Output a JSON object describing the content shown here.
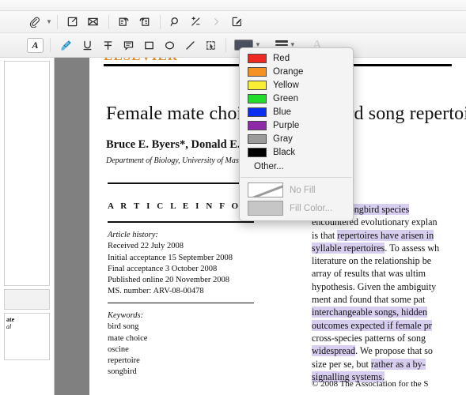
{
  "window": {
    "title": ""
  },
  "toolbar_top": {
    "items": [
      {
        "name": "attachment-icon",
        "label": "Attachment",
        "has_chevron": true
      },
      {
        "name": "export-icon",
        "label": "Export"
      },
      {
        "name": "mail-icon",
        "label": "Mail"
      },
      {
        "name": "rotate-left-icon",
        "label": "Rotate Left"
      },
      {
        "name": "rotate-right-icon",
        "label": "Rotate Right"
      },
      {
        "name": "search-icon",
        "label": "Search"
      },
      {
        "name": "crop-icon",
        "label": "Crop"
      },
      {
        "name": "chevron-right-icon",
        "label": "Next"
      },
      {
        "name": "markup-icon",
        "label": "Markup"
      }
    ]
  },
  "toolbar_markup": {
    "items": [
      {
        "name": "text-box-icon",
        "label": "Text Box"
      },
      {
        "name": "highlight-pen-icon",
        "label": "Highlight"
      },
      {
        "name": "underline-icon",
        "label": "Underline"
      },
      {
        "name": "strikethrough-icon",
        "label": "Strikethrough"
      },
      {
        "name": "note-icon",
        "label": "Note"
      },
      {
        "name": "rectangle-icon",
        "label": "Rectangle"
      },
      {
        "name": "oval-icon",
        "label": "Oval"
      },
      {
        "name": "line-icon",
        "label": "Line"
      },
      {
        "name": "selection-icon",
        "label": "Selection"
      }
    ],
    "border_color_swatch": "#4c5260",
    "border_color_label": "Border Color",
    "line_style_label": "Line Style",
    "font_label": "A"
  },
  "color_menu": {
    "colors": [
      {
        "label": "Red",
        "hex": "#ee2a23"
      },
      {
        "label": "Orange",
        "hex": "#f59122"
      },
      {
        "label": "Yellow",
        "hex": "#f9ee34"
      },
      {
        "label": "Green",
        "hex": "#22dd2c"
      },
      {
        "label": "Blue",
        "hex": "#0a2ff0"
      },
      {
        "label": "Purple",
        "hex": "#8e2aa8"
      },
      {
        "label": "Gray",
        "hex": "#9b9b9b"
      },
      {
        "label": "Black",
        "hex": "#000000"
      }
    ],
    "other_label": "Other...",
    "no_fill_label": "No Fill",
    "fill_color_label": "Fill Color...",
    "fill_color_swatch": "#c6c6c6"
  },
  "sidebar": {
    "thumbnails": [
      {
        "name": "page-thumbnail-1",
        "text_line1": "",
        "text_line2": "",
        "blank": true
      },
      {
        "name": "page-thumbnail-2",
        "text_line1": "",
        "text_line2": "",
        "blank": true
      },
      {
        "name": "page-thumbnail-3",
        "text_line1": "ate",
        "text_line2": "al",
        "blank": false
      }
    ]
  },
  "document": {
    "publisher": "ELSEVIER",
    "title": "Female mate choice and songbird song repertoires",
    "authors": "Bruce E. Byers*, Donald E. Kroodsma",
    "affiliation": "Department of Biology, University of Massachusetts, Amherst",
    "article_info_heading": "A R T I C L E  I N F O",
    "article_history": {
      "lead": "Article history:",
      "lines": [
        "Received 22 July 2008",
        "Initial acceptance 15 September 2008",
        "Final acceptance 3 October 2008",
        "Published online 20 November 2008",
        "MS. number: ARV-08-00478"
      ]
    },
    "keywords": {
      "lead": "Keywords:",
      "lines": [
        "bird song",
        "mate choice",
        "oscine",
        "repertoire",
        "songbird"
      ]
    },
    "abstract_lines": [
      [
        {
          "t": "of many songbird species",
          "hl": true
        }
      ],
      [
        {
          "t": "encountered evolutionary explan",
          "hl": false
        }
      ],
      [
        {
          "t": "is that ",
          "hl": false
        },
        {
          "t": "repertoires have arisen in",
          "hl": true
        }
      ],
      [
        {
          "t": "syllable repertoires",
          "hl": true
        },
        {
          "t": ". To assess wh",
          "hl": false
        }
      ],
      [
        {
          "t": "literature on the relationship be",
          "hl": false
        }
      ],
      [
        {
          "t": "array of results that was ultim",
          "hl": false
        }
      ],
      [
        {
          "t": "hypothesis. Given the ambiguity",
          "hl": false
        }
      ],
      [
        {
          "t": "ment and found that some pat",
          "hl": false
        }
      ],
      [
        {
          "t": "interchangeable songs, hidden",
          "hl": true
        }
      ],
      [
        {
          "t": "outcomes expected if female pr",
          "hl": true
        }
      ],
      [
        {
          "t": "cross-species patterns of song",
          "hl": false
        }
      ],
      [
        {
          "t": "widespread",
          "hl": true
        },
        {
          "t": ". We propose that so",
          "hl": false
        }
      ],
      [
        {
          "t": "size per se, but ",
          "hl": false
        },
        {
          "t": "rather as a by-",
          "hl": true
        }
      ],
      [
        {
          "t": "signalling systems.",
          "hl": true
        }
      ]
    ],
    "copyright": "© 2008 The Association for the S"
  }
}
